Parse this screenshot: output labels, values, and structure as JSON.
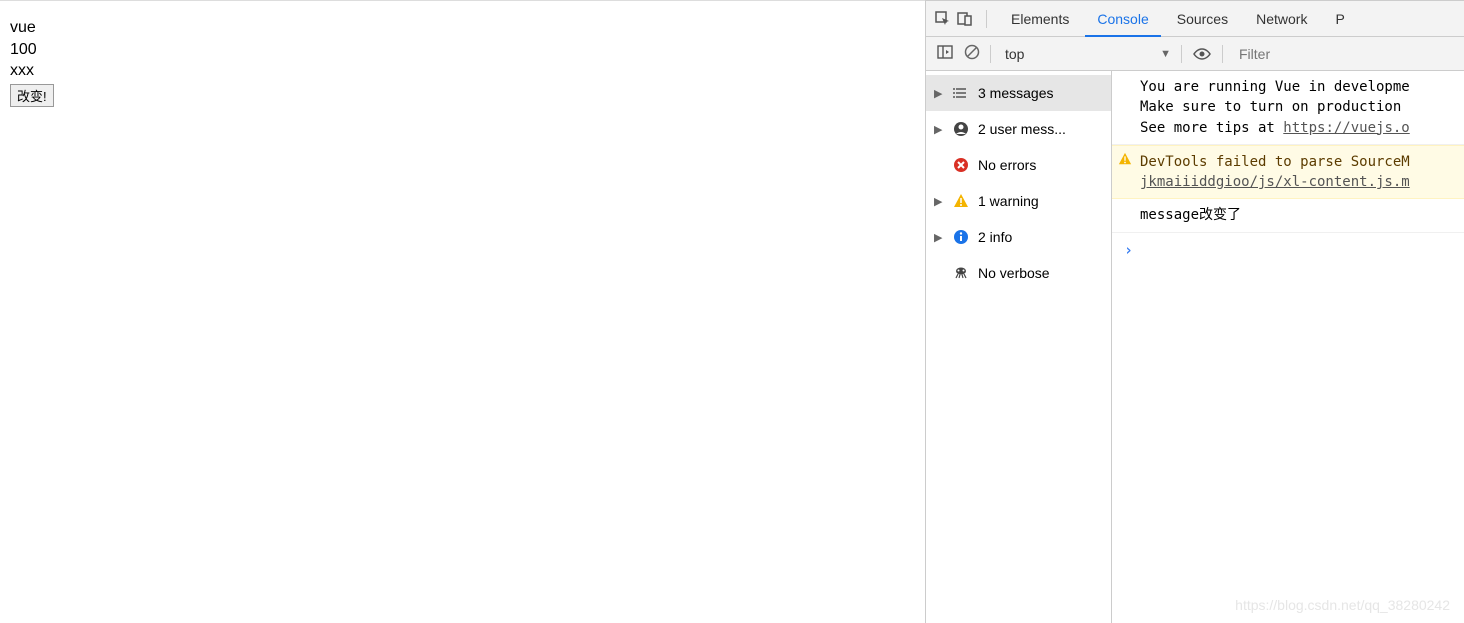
{
  "page": {
    "line1": "vue",
    "line2": "100",
    "line3": "xxx",
    "button_label": "改变!"
  },
  "devtools": {
    "tabs": [
      "Elements",
      "Console",
      "Sources",
      "Network",
      "P"
    ],
    "active_tab": "Console",
    "toolbar": {
      "context": "top",
      "filter_placeholder": "Filter"
    },
    "sidebar": [
      {
        "label": "3 messages",
        "arrow": true,
        "type": "messages",
        "selected": true
      },
      {
        "label": "2 user mess...",
        "arrow": true,
        "type": "user"
      },
      {
        "label": "No errors",
        "arrow": false,
        "type": "error"
      },
      {
        "label": "1 warning",
        "arrow": true,
        "type": "warning"
      },
      {
        "label": "2 info",
        "arrow": true,
        "type": "info"
      },
      {
        "label": "No verbose",
        "arrow": false,
        "type": "verbose"
      }
    ],
    "messages": {
      "log1_line1": "You are running Vue in developme",
      "log1_line2": "Make sure to turn on production ",
      "log1_line3_prefix": "See more tips at ",
      "log1_link": "https://vuejs.o",
      "warn_line1": "DevTools failed to parse SourceM",
      "warn_line2": "jkmaiiiddgioo/js/xl-content.js.m",
      "log2": "message改变了"
    }
  },
  "watermark": "https://blog.csdn.net/qq_38280242"
}
